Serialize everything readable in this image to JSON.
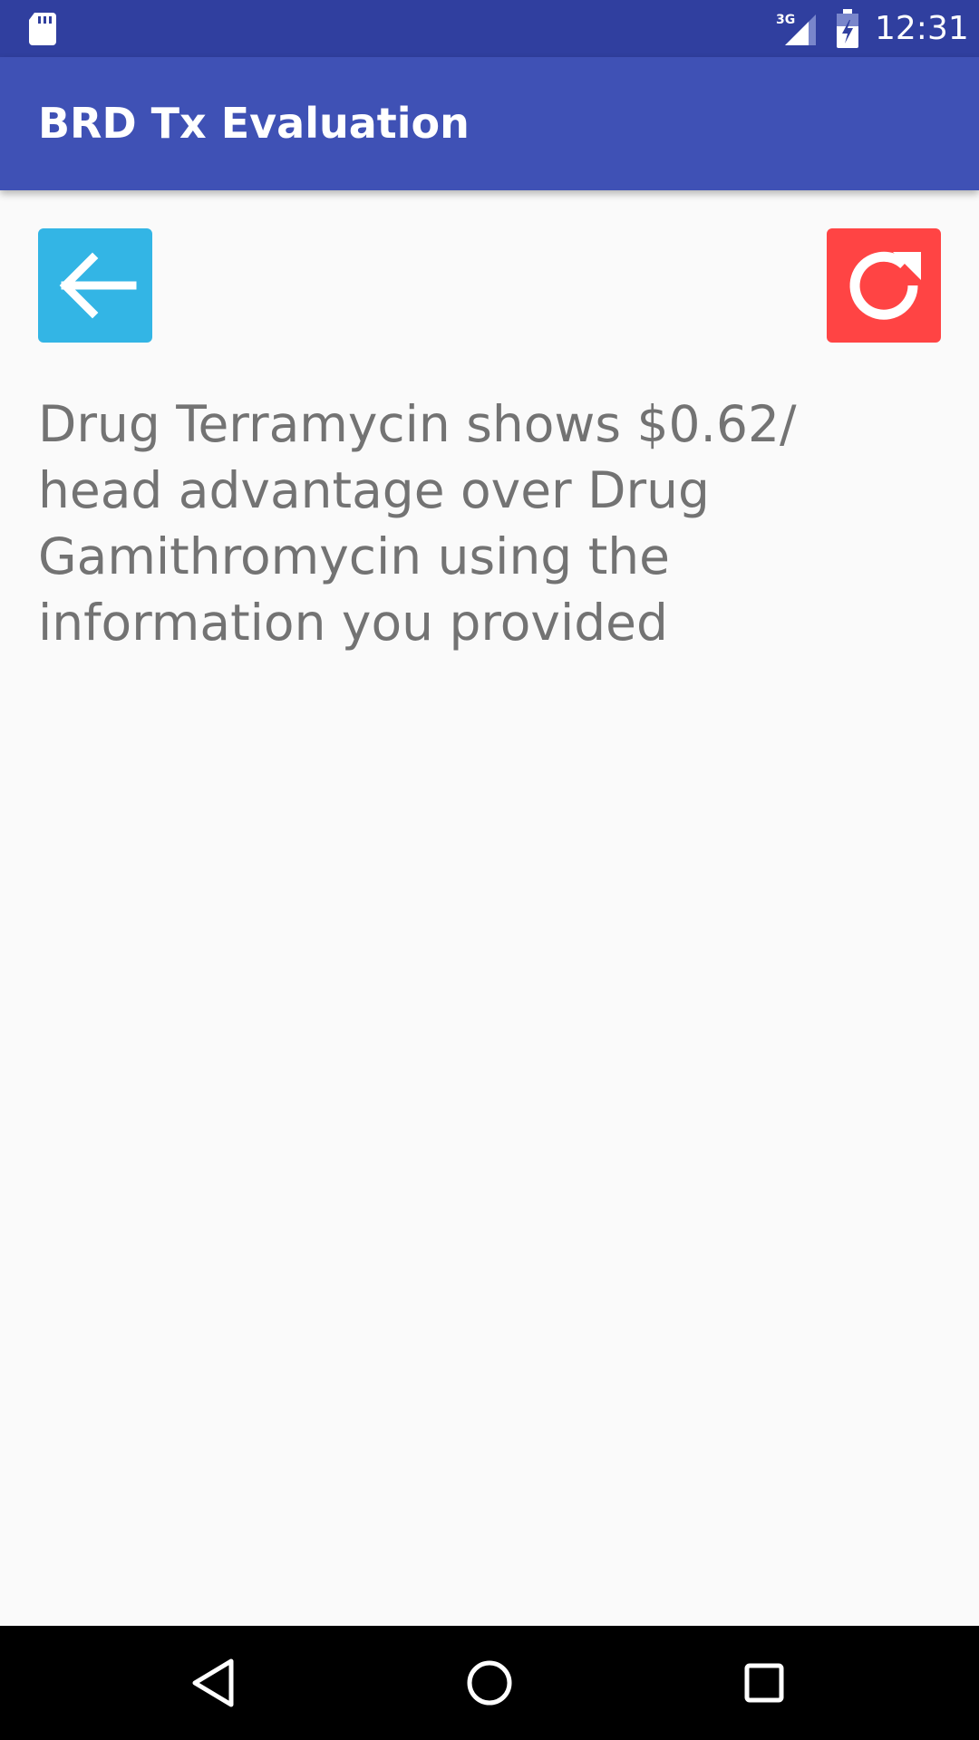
{
  "status_bar": {
    "time": "12:31",
    "network": "3G",
    "icons": [
      "sd-card-icon",
      "signal-icon",
      "battery-charging-icon"
    ]
  },
  "app_bar": {
    "title": "BRD Tx Evaluation"
  },
  "actions": {
    "back_icon": "arrow-left-icon",
    "back_color": "#33b5e5",
    "refresh_icon": "refresh-icon",
    "refresh_color": "#ff4444"
  },
  "result": {
    "message": "Drug Terramycin shows $0.62/ head advantage over Drug Gamithromycin using the information you provided"
  },
  "navigation": {
    "icons": [
      "nav-back-icon",
      "nav-home-icon",
      "nav-recents-icon"
    ]
  },
  "colors": {
    "status_bar": "#303f9f",
    "app_bar": "#3f51b5",
    "background": "#fafafa",
    "text": "#737373"
  }
}
